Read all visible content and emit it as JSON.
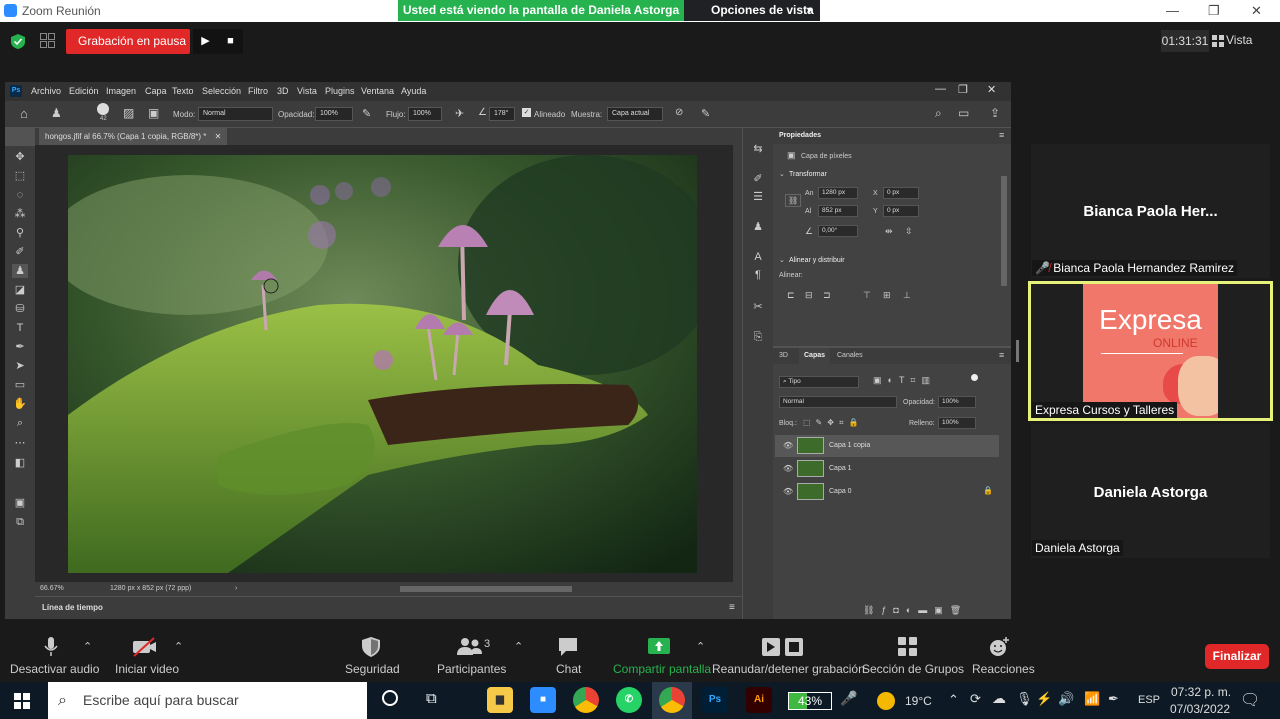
{
  "zoom_window": {
    "title": "Zoom Reunión",
    "share_banner": "Usted está viendo la pantalla de Daniela Astorga",
    "view_options": "Opciones de vista",
    "recording_label": "Grabación en pausa",
    "timer": "01:31:31",
    "view_label": "Vista"
  },
  "photoshop": {
    "menu": [
      "Archivo",
      "Edición",
      "Imagen",
      "Capa",
      "Texto",
      "Selección",
      "Filtro",
      "3D",
      "Vista",
      "Plugins",
      "Ventana",
      "Ayuda"
    ],
    "options_bar": {
      "brush_size": "42",
      "mode_label": "Modo:",
      "mode_value": "Normal",
      "opacity_label": "Opacidad:",
      "opacity_value": "100%",
      "flow_label": "Flujo:",
      "flow_value": "100%",
      "angle_value": "178°",
      "aligned_label": "Alineado",
      "sample_label": "Muestra:",
      "sample_value": "Capa actual"
    },
    "document_tab": "hongos.jfif al 66.7% (Capa 1 copia, RGB/8*) *",
    "status_zoom": "66.67%",
    "status_info": "1280 px x 852 px (72 ppp)",
    "timeline_label": "Línea de tiempo",
    "properties": {
      "tab": "Propiedades",
      "pixel_layer": "Capa de píxeles",
      "transform_section": "Transformar",
      "width_label": "An",
      "width_value": "1280 px",
      "x_label": "X",
      "x_value": "0 px",
      "height_label": "Al",
      "height_value": "852 px",
      "y_label": "Y",
      "y_value": "0 px",
      "angle_value": "0,00°",
      "align_section": "Alinear y distribuir",
      "align_label": "Alinear:"
    },
    "layers": {
      "tabs": [
        "3D",
        "Capas",
        "Canales"
      ],
      "filter_kind": "Tipo",
      "blend_mode": "Normal",
      "opacity_label": "Opacidad:",
      "opacity_value": "100%",
      "lock_label": "Bloq.:",
      "fill_label": "Relleno:",
      "fill_value": "100%",
      "items": [
        {
          "name": "Capa 1 copia",
          "selected": true,
          "locked": false
        },
        {
          "name": "Capa 1",
          "selected": false,
          "locked": false
        },
        {
          "name": "Capa 0",
          "selected": false,
          "locked": true
        }
      ]
    }
  },
  "participants": [
    {
      "big_name": "Bianca Paola Her...",
      "name": "Bianca Paola Hernandez Ramirez",
      "muted": true
    },
    {
      "name": "Expresa Cursos y Talleres",
      "thumb_title": "Expresa",
      "thumb_subtitle": "ONLINE",
      "active": true
    },
    {
      "big_name": "Daniela Astorga",
      "name": "Daniela Astorga"
    }
  ],
  "bottom_bar": {
    "mute": "Desactivar audio",
    "video": "Iniciar video",
    "security": "Seguridad",
    "participants": "Participantes",
    "participants_count": "3",
    "chat": "Chat",
    "share": "Compartir pantalla",
    "record": "Reanudar/detener grabación",
    "breakout": "Sección de Grupos",
    "reactions": "Reacciones",
    "end": "Finalizar"
  },
  "taskbar": {
    "search_placeholder": "Escribe aquí para buscar",
    "battery": "43%",
    "weather": "19°C",
    "language": "ESP",
    "time": "07:32 p. m.",
    "date": "07/03/2022"
  },
  "colors": {
    "zoom_green": "#26b34f",
    "zoom_red": "#e02828",
    "active_speaker": "#e7f27b",
    "ps_dark": "#3c3c3c"
  }
}
